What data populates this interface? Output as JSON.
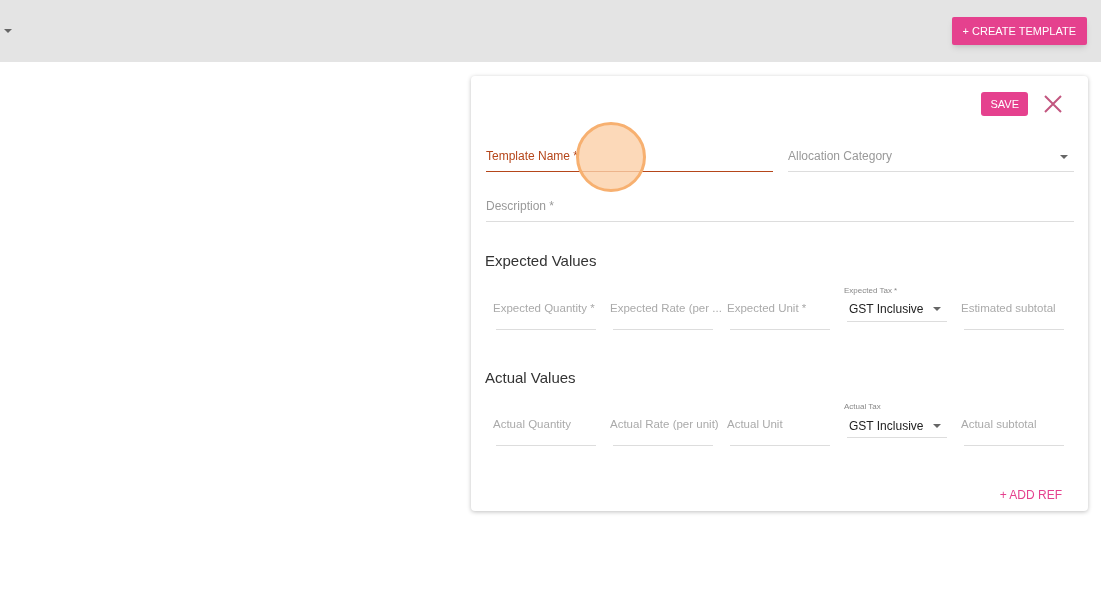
{
  "toolbar": {
    "create_button": "+ CREATE TEMPLATE"
  },
  "form": {
    "save_button": "SAVE",
    "template_name": {
      "label": "Template Name *",
      "focused": true
    },
    "allocation_category": {
      "label": "Allocation Category"
    },
    "description": {
      "label": "Description *",
      "focused": false
    },
    "sections": [
      {
        "title": "Expected Values",
        "fields": [
          {
            "kind": "text",
            "label": "Expected Quantity *"
          },
          {
            "kind": "text",
            "label": "Expected Rate (per ..."
          },
          {
            "kind": "text",
            "label": "Expected Unit *"
          },
          {
            "kind": "select",
            "label": "Expected Tax *",
            "value": "GST Inclusive"
          },
          {
            "kind": "text",
            "label": "Estimated subtotal"
          }
        ]
      },
      {
        "title": "Actual Values",
        "fields": [
          {
            "kind": "text",
            "label": "Actual Quantity"
          },
          {
            "kind": "text",
            "label": "Actual Rate (per unit)"
          },
          {
            "kind": "text",
            "label": "Actual Unit"
          },
          {
            "kind": "select",
            "label": "Actual Tax",
            "value": "GST Inclusive"
          },
          {
            "kind": "text",
            "label": "Actual subtotal"
          }
        ]
      }
    ],
    "add_ref_button": "+ ADD REF"
  }
}
